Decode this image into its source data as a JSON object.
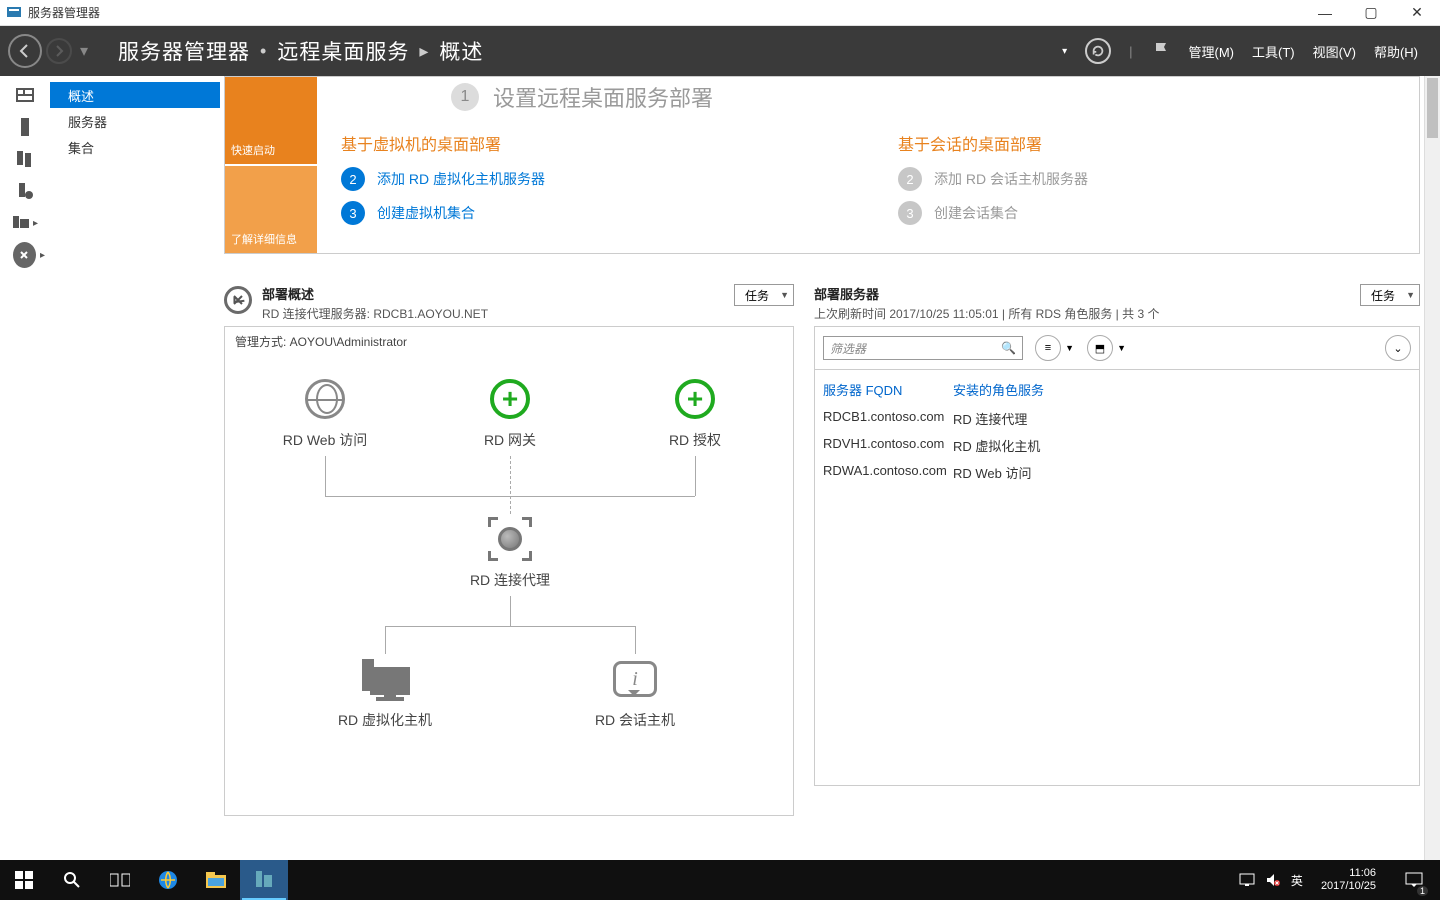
{
  "titlebar": {
    "app_title": "服务器管理器"
  },
  "breadcrumb": {
    "seg1": "服务器管理器",
    "seg2": "远程桌面服务",
    "seg3": "概述"
  },
  "menu": {
    "manage": "管理(M)",
    "tools": "工具(T)",
    "view": "视图(V)",
    "help": "帮助(H)"
  },
  "sidenav": {
    "overview": "概述",
    "servers": "服务器",
    "collections": "集合"
  },
  "tiles": {
    "quickstart": "快速启动",
    "learnmore": "了解详细信息"
  },
  "setup": {
    "title": "设置远程桌面服务部署",
    "vm_heading": "基于虚拟机的桌面部署",
    "session_heading": "基于会话的桌面部署",
    "step2_vm": "添加 RD 虚拟化主机服务器",
    "step3_vm": "创建虚拟机集合",
    "step2_sess": "添加 RD 会话主机服务器",
    "step3_sess": "创建会话集合"
  },
  "deploy_overview": {
    "title": "部署概述",
    "sub": "RD 连接代理服务器: RDCB1.AOYOU.NET",
    "tasks": "任务",
    "managed_by": "管理方式: AOYOU\\Administrator",
    "nodes": {
      "web": "RD Web 访问",
      "gateway": "RD 网关",
      "license": "RD 授权",
      "broker": "RD 连接代理",
      "vh": "RD 虚拟化主机",
      "sh": "RD 会话主机"
    }
  },
  "deploy_servers": {
    "title": "部署服务器",
    "sub": "上次刷新时间 2017/10/25 11:05:01 | 所有 RDS 角色服务  | 共 3 个",
    "tasks": "任务",
    "filter_placeholder": "筛选器",
    "col_fqdn": "服务器 FQDN",
    "col_role": "安装的角色服务",
    "rows": [
      {
        "fqdn": "RDCB1.contoso.com",
        "role": "RD 连接代理"
      },
      {
        "fqdn": "RDVH1.contoso.com",
        "role": "RD 虚拟化主机"
      },
      {
        "fqdn": "RDWA1.contoso.com",
        "role": "RD Web 访问"
      }
    ]
  },
  "taskbar": {
    "ime": "英",
    "time": "11:06",
    "date": "2017/10/25",
    "notif_count": "1"
  }
}
